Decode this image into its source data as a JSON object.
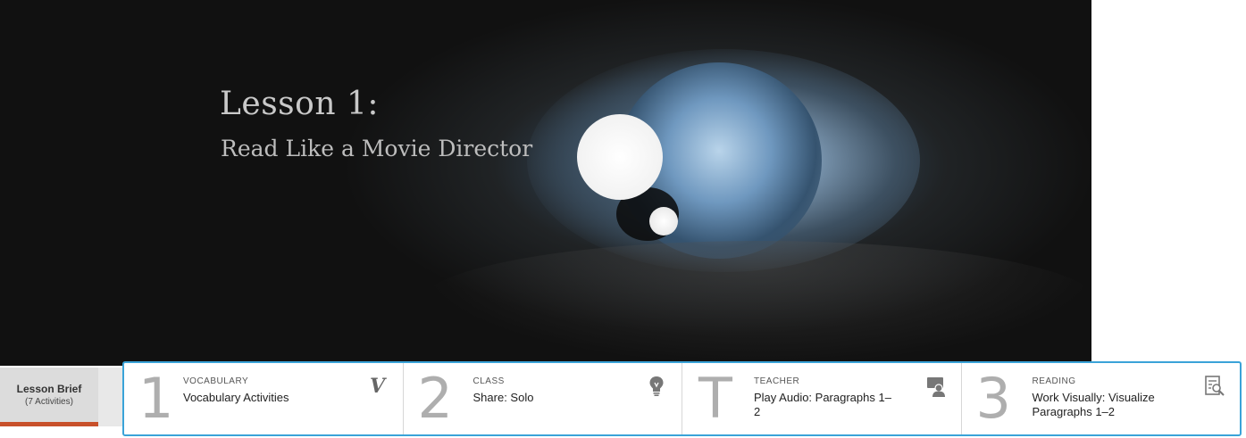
{
  "hero": {
    "title": "Lesson 1:",
    "subtitle": "Read Like a Movie Director"
  },
  "brief_tab": {
    "label": "Lesson Brief",
    "count": "(7 Activities)"
  },
  "activities": [
    {
      "number": "1",
      "category": "VOCABULARY",
      "title": "Vocabulary Activities",
      "icon": "vocabulary-v-icon",
      "icon_glyph": "V"
    },
    {
      "number": "2",
      "category": "CLASS",
      "title": "Share: Solo",
      "icon": "lightbulb-icon"
    },
    {
      "number": "T",
      "category": "TEACHER",
      "title": "Play Audio: Paragraphs 1–2",
      "icon": "teacher-presenter-icon"
    },
    {
      "number": "3",
      "category": "READING",
      "title": "Work Visually: Visualize Paragraphs 1–2",
      "icon": "document-search-icon"
    }
  ],
  "colors": {
    "accent_border": "#3aa3d8",
    "tab_underline": "#c8502a"
  }
}
